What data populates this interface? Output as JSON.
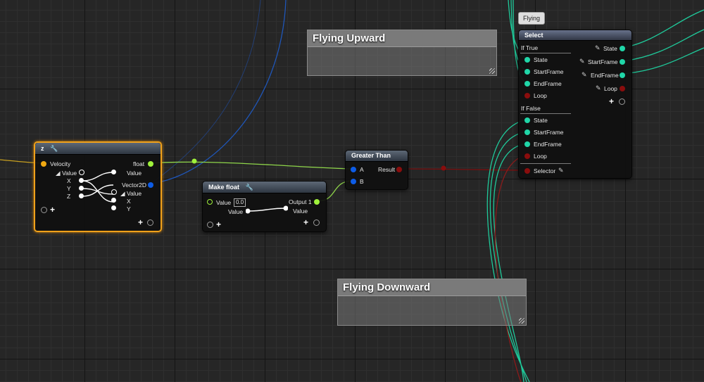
{
  "colors": {
    "struct_pin": "#f0a812",
    "float_pin": "#9ff13b",
    "vector2d_pin": "#0d5ce6",
    "bool_pin": "#8a0d0d",
    "state_pin": "#20d6a8",
    "selected_outline": "#f0a11a"
  },
  "icons": {
    "wrench": "wrench-icon",
    "pencil": "pencil-icon",
    "plus": "plus-icon",
    "exec": "exec-pin-icon"
  },
  "comments": {
    "flying_upward": "Flying Upward",
    "flying_downward": "Flying Downward"
  },
  "tooltip": {
    "text": "Flying"
  },
  "z_node": {
    "title": "z",
    "input_label": "Velocity",
    "value_label": "Value",
    "x_label": "X",
    "y_label": "Y",
    "z_label": "Z",
    "float_out": "float",
    "float_value": "Value",
    "vec2_out": "Vector2D",
    "vec2_value": "Value",
    "vec2_x": "X",
    "vec2_y": "Y"
  },
  "make_float": {
    "title": "Make float",
    "value_label": "Value",
    "value_default": "0.0",
    "value_inner": "Value",
    "output_label": "Output 1",
    "output_value": "Value"
  },
  "greater_than": {
    "title": "Greater Than",
    "a_label": "A",
    "b_label": "B",
    "result_label": "Result"
  },
  "select_node": {
    "title": "Select",
    "if_true": "If True",
    "if_false": "If False",
    "true_pins": [
      "State",
      "StartFrame",
      "EndFrame",
      "Loop"
    ],
    "false_pins": [
      "State",
      "StartFrame",
      "EndFrame",
      "Loop"
    ],
    "selector_label": "Selector",
    "outputs": [
      "State",
      "StartFrame",
      "EndFrame",
      "Loop"
    ]
  }
}
